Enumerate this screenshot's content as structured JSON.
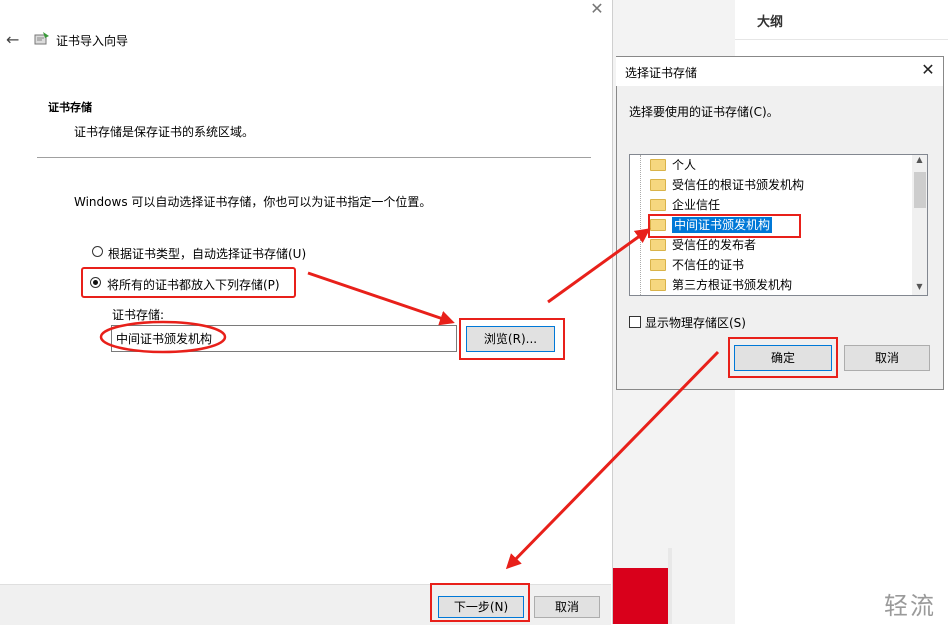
{
  "background": {
    "outline_title": "大纲",
    "watermark": "轻流"
  },
  "wizard": {
    "title": "证书导入向导",
    "section_title": "证书存储",
    "section_desc": "证书存储是保存证书的系统区域。",
    "instruction": "Windows 可以自动选择证书存储，你也可以为证书指定一个位置。",
    "radio_auto_label": "根据证书类型，自动选择证书存储(U)",
    "radio_manual_label": "将所有的证书都放入下列存储(P)",
    "selected_option": "manual",
    "store_label": "证书存储:",
    "store_value": "中间证书颁发机构",
    "browse_label": "浏览(R)...",
    "next_label": "下一步(N)",
    "cancel_label": "取消"
  },
  "dialog": {
    "title": "选择证书存储",
    "instruction": "选择要使用的证书存储(C)。",
    "stores": [
      {
        "label": "个人",
        "selected": false
      },
      {
        "label": "受信任的根证书颁发机构",
        "selected": false
      },
      {
        "label": "企业信任",
        "selected": false
      },
      {
        "label": "中间证书颁发机构",
        "selected": true
      },
      {
        "label": "受信任的发布者",
        "selected": false
      },
      {
        "label": "不信任的证书",
        "selected": false
      },
      {
        "label": "第三方根证书颁发机构",
        "selected": false
      }
    ],
    "show_physical_label": "显示物理存储区(S)",
    "show_physical_checked": false,
    "ok_label": "确定",
    "cancel_label": "取消"
  },
  "colors": {
    "annotation": "#e8201a",
    "selection": "#0078d7",
    "folder": "#f6d77f"
  }
}
